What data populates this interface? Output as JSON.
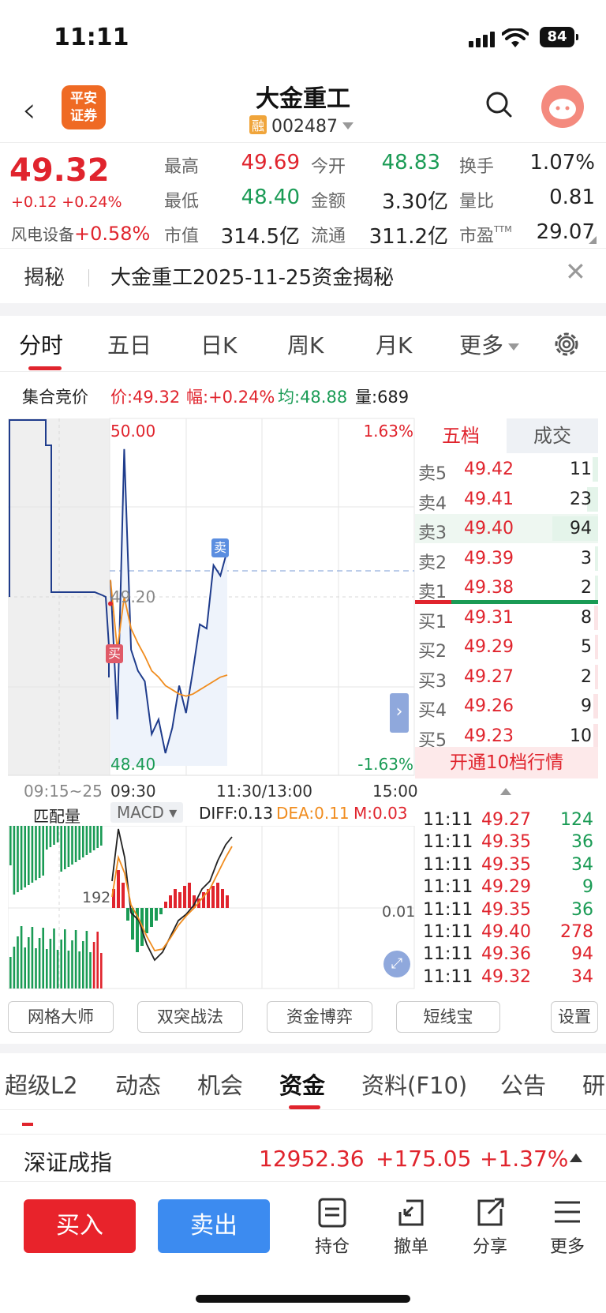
{
  "status": {
    "time": "11:11",
    "battery": "84"
  },
  "header": {
    "title": "大金重工",
    "rong": "融",
    "code": "002487",
    "logo_line1": "平安",
    "logo_line2": "证券"
  },
  "quote": {
    "price": "49.32",
    "change": "+0.12",
    "change_pct": "+0.24%",
    "sector_name": "风电设备",
    "sector_pct": "+0.58%",
    "labels": {
      "high": "最高",
      "low": "最低",
      "mktcap": "市值",
      "open": "今开",
      "amount": "金额",
      "float": "流通",
      "turnover": "换手",
      "volratio": "量比",
      "pe": "市盈",
      "ttm": "TTM"
    },
    "values": {
      "high": "49.69",
      "low": "48.40",
      "mktcap": "314.5亿",
      "open": "48.83",
      "amount": "3.30亿",
      "float": "311.2亿",
      "turnover": "1.07%",
      "volratio": "0.81",
      "pe": "29.07"
    }
  },
  "reveal": {
    "label": "揭秘",
    "text": "大金重工2025-11-25资金揭秘"
  },
  "chart_tabs": [
    "分时",
    "五日",
    "日K",
    "周K",
    "月K",
    "更多"
  ],
  "infobar": {
    "label": "集合竞价",
    "price": "价:49.32",
    "amp": "幅:+0.24%",
    "avg": "均:48.88",
    "vol": "量:689"
  },
  "chart": {
    "y_top": "50.00",
    "y_mid": "49.20",
    "y_bot": "48.40",
    "pct_top": "1.63%",
    "pct_bot": "-1.63%",
    "times": {
      "pre": "09:15~25",
      "open": "09:30",
      "mid": "11:30/13:00",
      "close": "15:00"
    },
    "buy_tag": "买",
    "sell_tag": "卖"
  },
  "chart_data": {
    "type": "line",
    "title": "",
    "ylim": [
      48.4,
      50.0
    ],
    "series": [
      {
        "name": "",
        "values": [
          49.28,
          48.62,
          49.9,
          48.95,
          48.85,
          48.8,
          48.55,
          48.62,
          48.46,
          48.58,
          48.78,
          48.65,
          48.85,
          49.07,
          49.05,
          49.35,
          49.3,
          49.42
        ]
      },
      {
        "name": "",
        "values": [
          49.28,
          48.95,
          49.2,
          49.05,
          48.98,
          48.92,
          48.85,
          48.82,
          48.78,
          48.76,
          48.74,
          48.73,
          48.74,
          48.76,
          48.78,
          48.8,
          48.82,
          48.83
        ]
      }
    ]
  },
  "orderbook": {
    "tabs": [
      "五档",
      "成交"
    ],
    "asks": [
      {
        "name": "卖5",
        "price": "49.42",
        "vol": "11",
        "ratio": 0.12
      },
      {
        "name": "卖4",
        "price": "49.41",
        "vol": "23",
        "ratio": 0.24
      },
      {
        "name": "卖3",
        "price": "49.40",
        "vol": "94",
        "ratio": 1.0
      },
      {
        "name": "卖2",
        "price": "49.39",
        "vol": "3",
        "ratio": 0.04
      },
      {
        "name": "卖1",
        "price": "49.38",
        "vol": "2",
        "ratio": 0.03
      }
    ],
    "bids": [
      {
        "name": "买1",
        "price": "49.31",
        "vol": "8",
        "ratio": 0.09
      },
      {
        "name": "买2",
        "price": "49.29",
        "vol": "5",
        "ratio": 0.06
      },
      {
        "name": "买3",
        "price": "49.27",
        "vol": "2",
        "ratio": 0.03
      },
      {
        "name": "买4",
        "price": "49.26",
        "vol": "9",
        "ratio": 0.1
      },
      {
        "name": "买5",
        "price": "49.23",
        "vol": "10",
        "ratio": 0.11
      }
    ],
    "open10": "开通10档行情",
    "trades": [
      {
        "time": "11:11",
        "price": "49.27",
        "vol": "124",
        "side": "sell"
      },
      {
        "time": "11:11",
        "price": "49.35",
        "vol": "36",
        "side": "sell"
      },
      {
        "time": "11:11",
        "price": "49.35",
        "vol": "34",
        "side": "sell"
      },
      {
        "time": "11:11",
        "price": "49.29",
        "vol": "9",
        "side": "sell"
      },
      {
        "time": "11:11",
        "price": "49.35",
        "vol": "36",
        "side": "sell"
      },
      {
        "time": "11:11",
        "price": "49.40",
        "vol": "278",
        "side": "buy"
      },
      {
        "time": "11:11",
        "price": "49.36",
        "vol": "94",
        "side": "buy"
      },
      {
        "time": "11:11",
        "price": "49.32",
        "vol": "34",
        "side": "buy"
      }
    ]
  },
  "macd": {
    "match_label": "匹配量",
    "indicator": "MACD",
    "diff": "DIFF:0.13",
    "dea": "DEA:0.11",
    "m": "M:0.03",
    "left_val": "192",
    "right_val": "0.01"
  },
  "tools": [
    "网格大师",
    "双突战法",
    "资金博弈",
    "短线宝",
    "设置"
  ],
  "bottom_tabs": [
    "超级L2",
    "动态",
    "机会",
    "资金",
    "资料(F10)",
    "公告",
    "研"
  ],
  "index": {
    "name": "深证成指",
    "value": "12952.36",
    "change": "+175.05",
    "pct": "+1.37%"
  },
  "actions": {
    "buy": "买入",
    "sell": "卖出",
    "position": "持仓",
    "cancel": "撤单",
    "share": "分享",
    "more": "更多"
  },
  "colors": {
    "up": "#e0242d",
    "down": "#1a9b55",
    "line": "#1f3c8c",
    "avg": "#f08c1e",
    "buy_btn": "#e8232b",
    "sell_btn": "#3c8bf0"
  }
}
